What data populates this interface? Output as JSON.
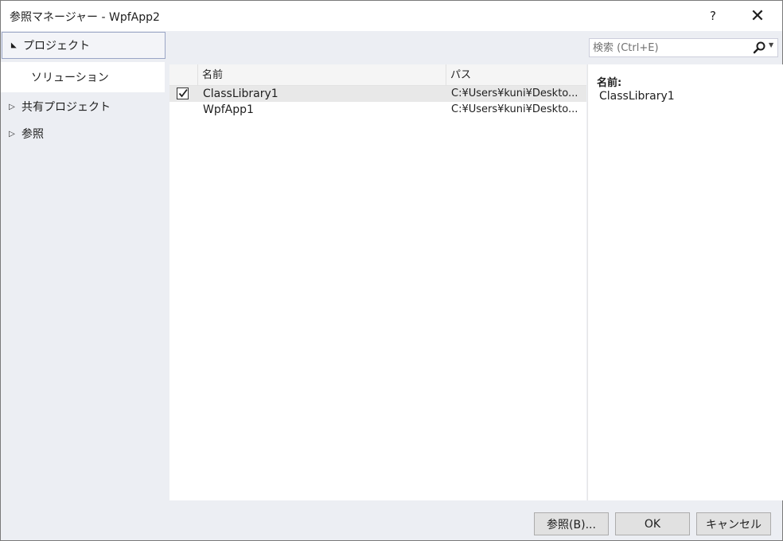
{
  "window": {
    "title": "参照マネージャー - WpfApp2",
    "help_label": "?",
    "close_label": "✕"
  },
  "nav": {
    "project_label": "プロジェクト",
    "project_arrow": "◢",
    "solution_label": "ソリューション",
    "shared_label": "共有プロジェクト",
    "ref_label": "参照",
    "collapsed_arrow": "▷"
  },
  "search": {
    "placeholder": "検索 (Ctrl+E)",
    "icon": "search-icon"
  },
  "list": {
    "columns": [
      "名前",
      "パス"
    ],
    "rows": [
      {
        "checked": true,
        "name": "ClassLibrary1",
        "path": "C:¥Users¥kuni¥Deskto..."
      },
      {
        "checked": false,
        "name": "WpfApp1",
        "path": "C:¥Users¥kuni¥Deskto..."
      }
    ]
  },
  "details": {
    "name_label": "名前:",
    "name_value": "ClassLibrary1"
  },
  "buttons": {
    "browse": "参照(B)...",
    "ok": "OK",
    "cancel": "キャンセル"
  }
}
